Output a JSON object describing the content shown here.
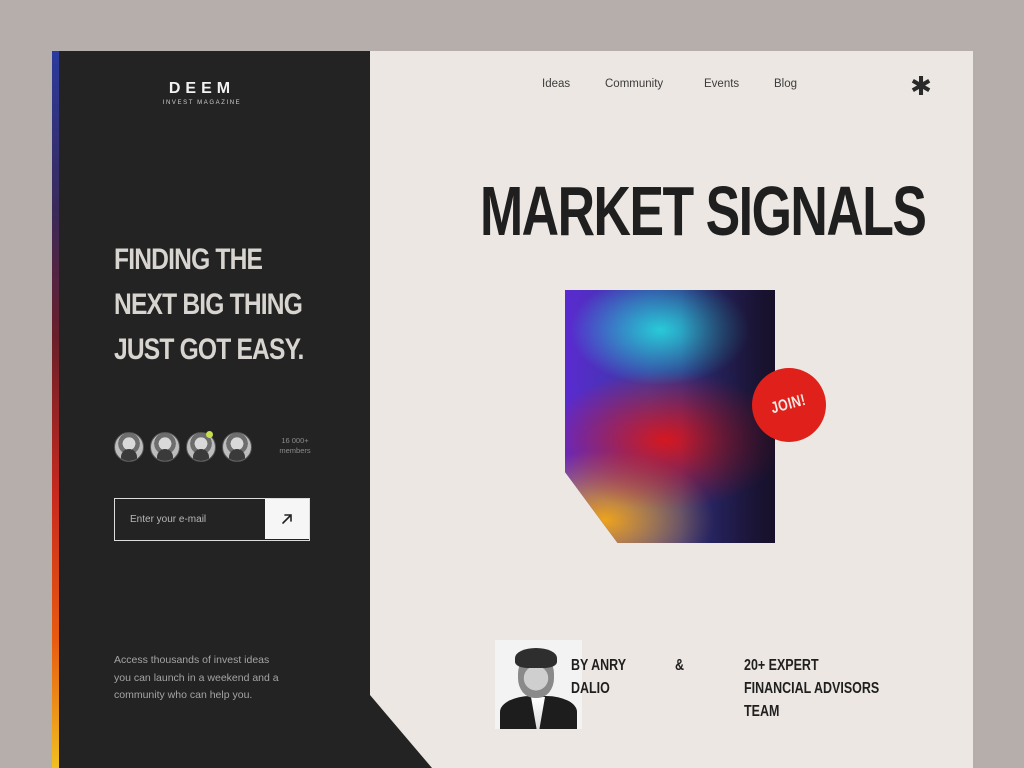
{
  "brand": {
    "name": "DEEM",
    "tagline": "INVEST MAGAZINE"
  },
  "nav": {
    "items": [
      "Ideas",
      "Community",
      "Events",
      "Blog"
    ]
  },
  "icons": {
    "menu": "asterisk-icon",
    "submit": "arrow-up-right-icon"
  },
  "hero": {
    "headline": [
      "FINDING THE",
      "NEXT BIG THING",
      "JUST GOT EASY."
    ]
  },
  "community": {
    "members_count": "16 000+",
    "members_label": "members",
    "online_color": "#c6e04a"
  },
  "signup": {
    "placeholder": "Enter your e-mail",
    "value": ""
  },
  "description": "Access thousands of invest ideas you can launch in a weekend and a community who can help you.",
  "main": {
    "title": "MARKET SIGNALS",
    "join_label": "JOIN!",
    "author": [
      "BY ANRY",
      "DALIO"
    ],
    "ampersand": "&",
    "team": [
      "20+ EXPERT",
      "FINANCIAL ADVISORS",
      "TEAM"
    ]
  },
  "colors": {
    "panel_dark": "#232323",
    "background": "#ece7e2",
    "accent_red": "#e0201a"
  }
}
